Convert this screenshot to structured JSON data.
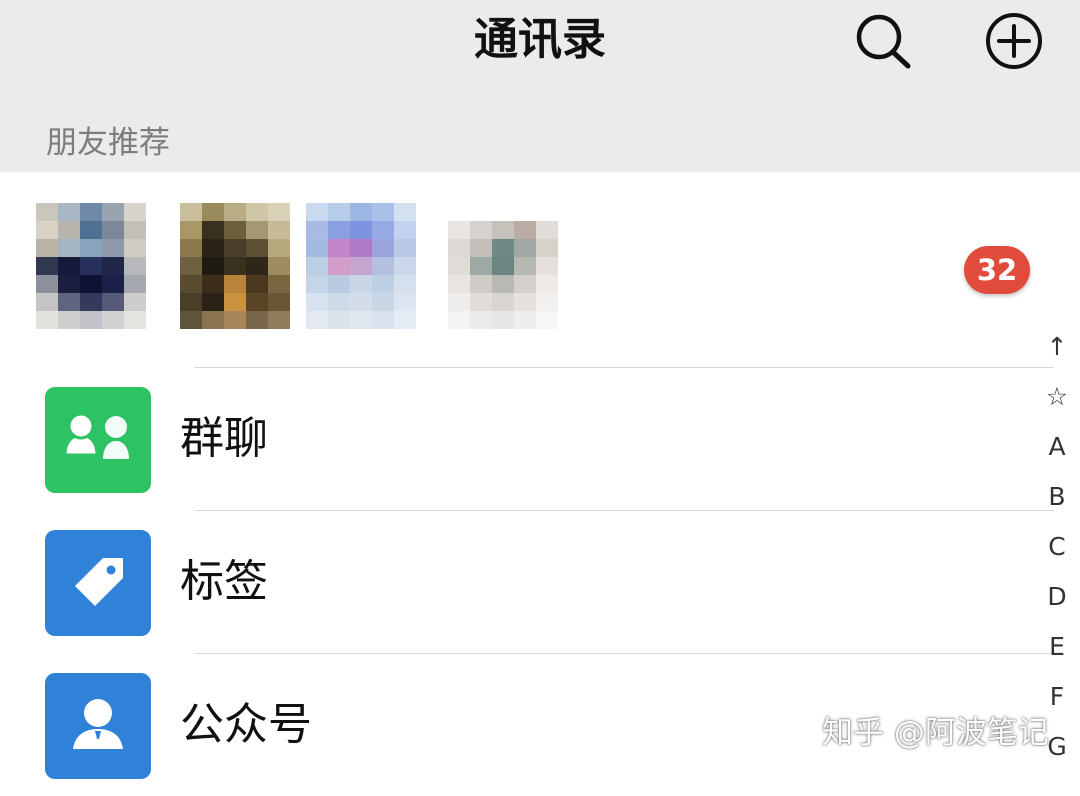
{
  "header": {
    "title": "通讯录",
    "search_icon": "search-icon",
    "add_icon": "add-circle-icon",
    "background_color": "#ebebeb"
  },
  "recommend": {
    "section_label": "朋友推荐",
    "badge_count": "32",
    "badge_color": "#e04b3c",
    "avatars": [
      "avatar-1",
      "avatar-2",
      "avatar-3",
      "avatar-4"
    ]
  },
  "rows": [
    {
      "label": "群聊",
      "icon": "group-chat-icon",
      "color": "#2dc263"
    },
    {
      "label": "标签",
      "icon": "tag-icon",
      "color": "#2f82d7"
    },
    {
      "label": "公众号",
      "icon": "official-account-icon",
      "color": "#2f82d7"
    }
  ],
  "index_bar": [
    "↑",
    "☆",
    "A",
    "B",
    "C",
    "D",
    "E",
    "F",
    "G"
  ],
  "watermark": "知乎 @阿波笔记"
}
